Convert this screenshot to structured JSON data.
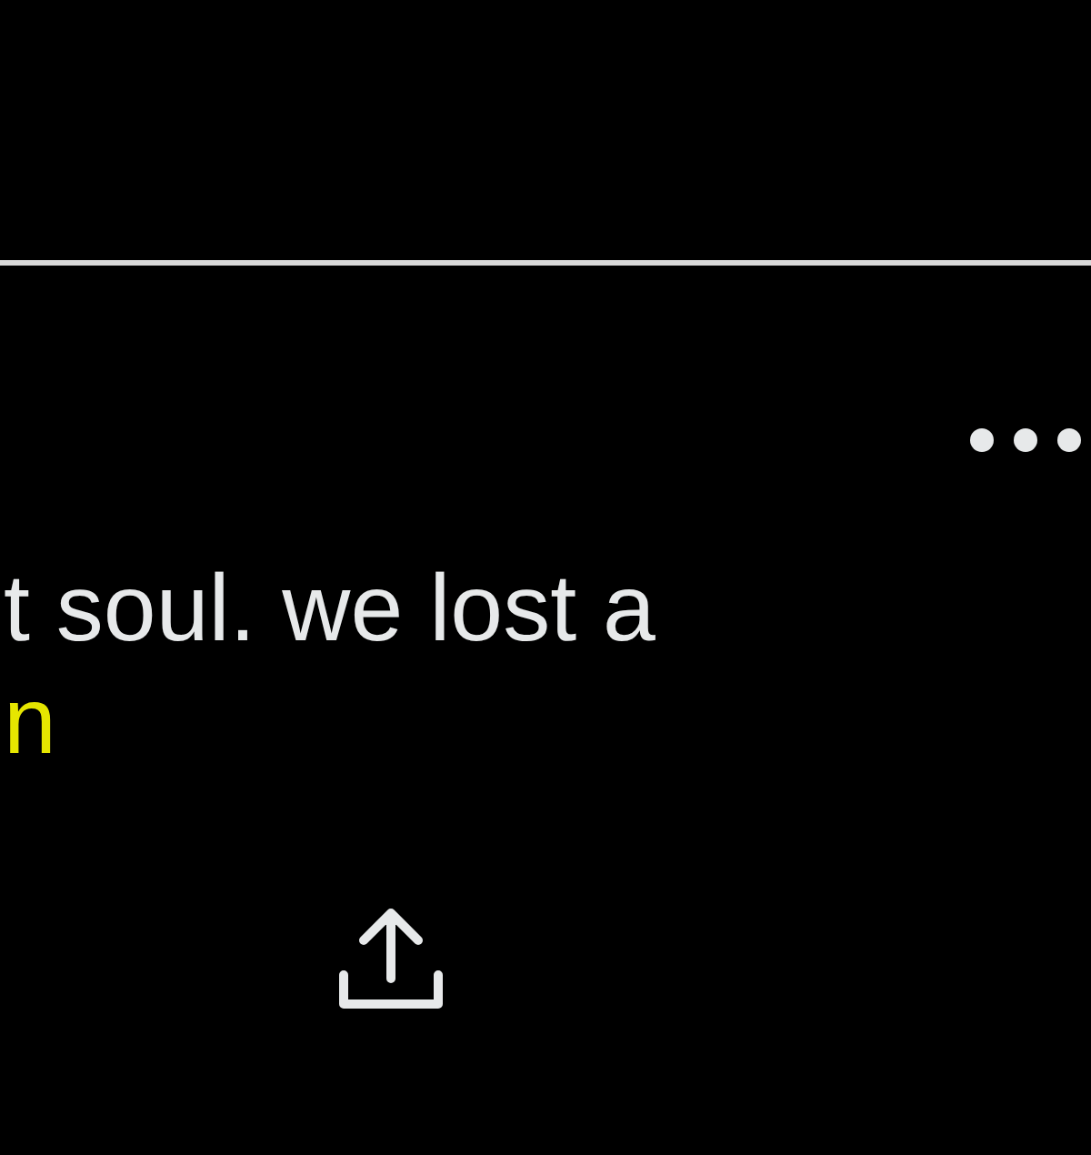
{
  "post": {
    "text_lines": [
      {
        "text": "t soul. we lost a",
        "kind": "plain"
      },
      {
        "text": "n",
        "kind": "link"
      }
    ]
  }
}
